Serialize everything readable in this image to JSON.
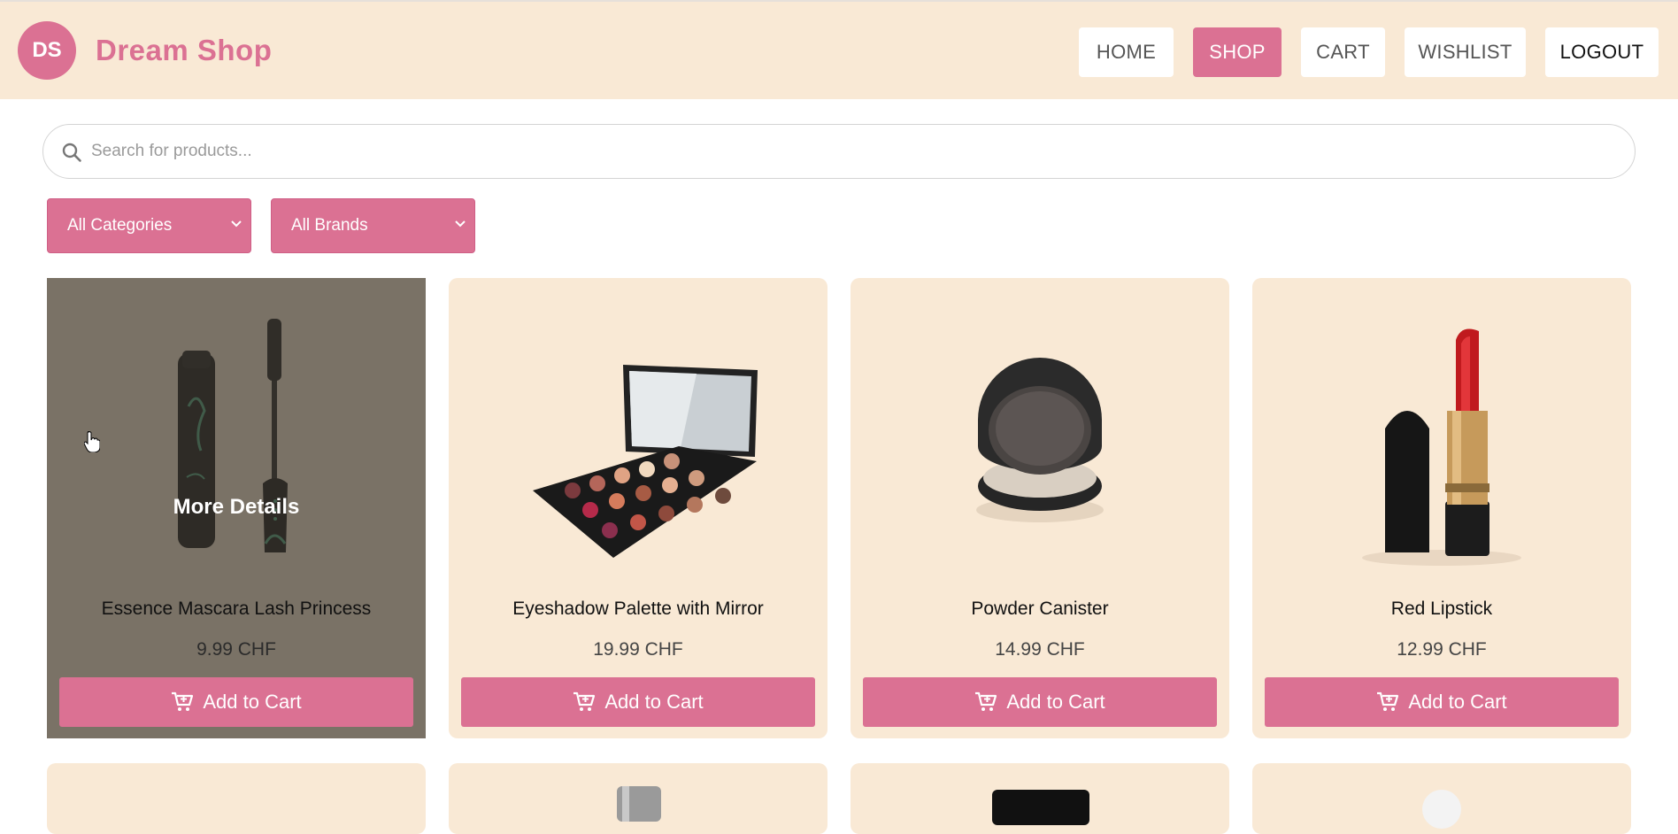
{
  "header": {
    "logo_initials": "DS",
    "brand": "Dream Shop",
    "nav": [
      {
        "label": "HOME",
        "active": false
      },
      {
        "label": "SHOP",
        "active": true
      },
      {
        "label": "CART",
        "active": false
      },
      {
        "label": "WISHLIST",
        "active": false
      },
      {
        "label": "LOGOUT",
        "active": false
      }
    ]
  },
  "search": {
    "placeholder": "Search for products...",
    "value": "",
    "icon": "search-icon"
  },
  "filters": {
    "category": "All Categories",
    "brand": "All Brands"
  },
  "products": [
    {
      "name": "Essence Mascara Lash Princess",
      "price": "9.99 CHF",
      "button": "Add to Cart",
      "overlay": "More Details"
    },
    {
      "name": "Eyeshadow Palette with Mirror",
      "price": "19.99 CHF",
      "button": "Add to Cart"
    },
    {
      "name": "Powder Canister",
      "price": "14.99 CHF",
      "button": "Add to Cart"
    },
    {
      "name": "Red Lipstick",
      "price": "12.99 CHF",
      "button": "Add to Cart"
    }
  ],
  "colors": {
    "accent": "#db7193",
    "header_bg": "#f9e9d5",
    "card_bg": "#f9e9d5"
  }
}
